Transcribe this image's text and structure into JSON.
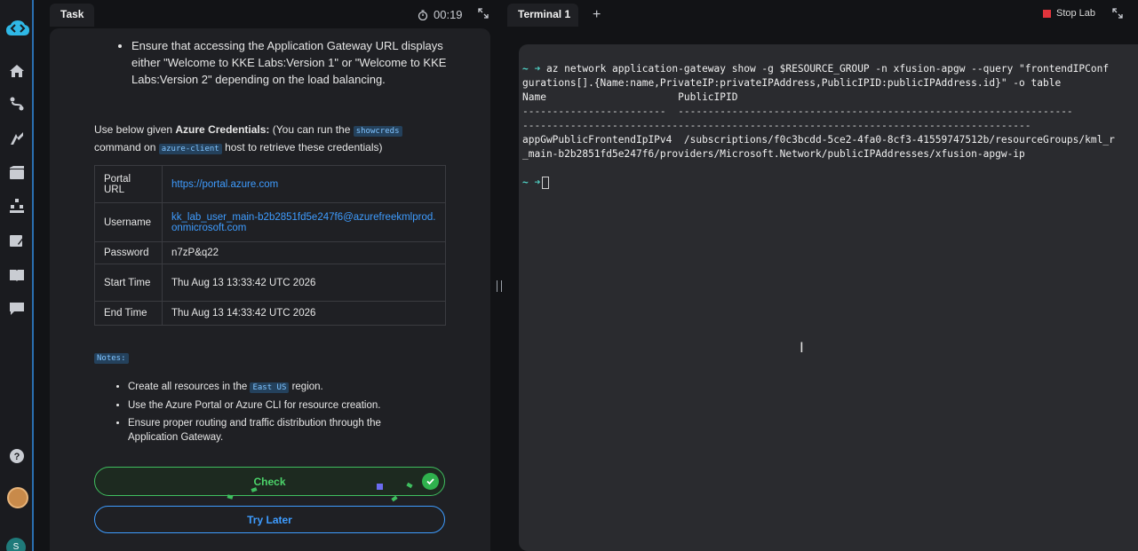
{
  "rail": {
    "icons": [
      "home-icon",
      "routes-icon",
      "roadmap-icon",
      "labs-icon",
      "certification-icon",
      "notes-icon",
      "library-icon",
      "chat-icon",
      "help-icon"
    ],
    "user_initial": "S"
  },
  "task": {
    "tab_label": "Task",
    "timer": "00:19",
    "bullet_top": "Ensure that accessing the Application Gateway URL displays either \"Welcome to KKE Labs:Version 1\" or \"Welcome to KKE Labs:Version 2\" depending on the load balancing.",
    "creds_intro_prefix": "Use below given ",
    "creds_intro_bold": "Azure Credentials:",
    "creds_intro_middle": " (You can run the ",
    "creds_chip_1": "showcreds",
    "creds_intro_command": " command on ",
    "creds_chip_2": "azure-client",
    "creds_intro_suffix": " host to retrieve these credentials)",
    "credentials": [
      {
        "key": "Portal URL",
        "value": "https://portal.azure.com"
      },
      {
        "key": "Username",
        "value": "kk_lab_user_main-b2b2851fd5e247f6@azurefreekmlprod.onmicrosoft.com"
      },
      {
        "key": "Password",
        "value": "n7zP&q22"
      },
      {
        "key": "Start Time",
        "value": "Thu Aug 13 13:33:42 UTC 2026"
      },
      {
        "key": "End Time",
        "value": "Thu Aug 13 14:33:42 UTC 2026"
      }
    ],
    "notes_label": "Notes:",
    "note_1_prefix": "Create all resources in the ",
    "note_1_chip": "East US",
    "note_1_suffix": " region.",
    "note_2": "Use the Azure Portal or Azure CLI for resource creation.",
    "note_3": "Ensure proper routing and traffic distribution through the Application Gateway.",
    "check_label": "Check",
    "try_later_label": "Try Later"
  },
  "terminal": {
    "tab_label": "Terminal 1",
    "add_tab": "+",
    "stop_label": "Stop Lab",
    "prompt": "~ ➜",
    "command_line_1": " az network application-gateway show -g $RESOURCE_GROUP -n xfusion-apgw --query \"frontendIPConf",
    "command_line_2": "gurations[].{Name:name,PrivateIP:privateIPAddress,PublicIPID:publicIPAddress.id}\" -o table",
    "header_line": "Name                      PublicIPID",
    "dash_line_1": "------------------------  ------------------------------------------------------------------",
    "dash_line_2": "-------------------------------------------------------------------------------------",
    "row_line_1": "appGwPublicFrontendIpIPv4  /subscriptions/f0c3bcdd-5ce2-4fa0-8cf3-41559747512b/resourceGroups/kml_r",
    "row_line_2": "_main-b2b2851fd5e247f6/providers/Microsoft.Network/publicIPAddresses/xfusion-apgw-ip"
  }
}
